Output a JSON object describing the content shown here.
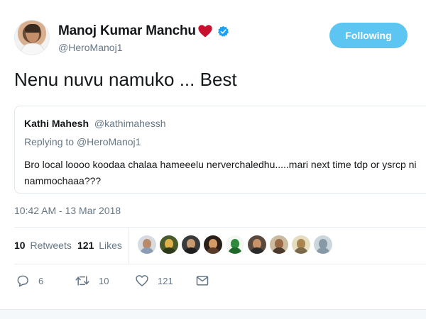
{
  "author": {
    "name": "Manoj Kumar Manchu",
    "handle": "@HeroManoj1",
    "icons": [
      "heart-icon",
      "verified-badge-icon"
    ],
    "accent_color": "#1da1f2"
  },
  "follow_button": {
    "label": "Following",
    "color": "#5cc5f2"
  },
  "tweet": {
    "text": "Nenu nuvu namuko ... Best"
  },
  "quoted_tweet": {
    "name": "Kathi Mahesh",
    "handle": "@kathimahessh",
    "replying_prefix": "Replying to",
    "replying_to": "@HeroManoj1",
    "text": "Bro local loooo koodaa chalaa hameeelu nerverchaledhu.....mari next time tdp or ysrcp ni nammochaaa???"
  },
  "timestamp": "10:42 AM - 13 Mar 2018",
  "stats": {
    "retweets_count": "10",
    "retweets_label": "Retweets",
    "likes_count": "121",
    "likes_label": "Likes"
  },
  "likers_count_shown": 9,
  "actions": {
    "reply_count": "6",
    "retweet_count": "10",
    "like_count": "121",
    "icons": [
      "reply-icon",
      "retweet-icon",
      "like-icon",
      "direct-message-icon"
    ]
  }
}
